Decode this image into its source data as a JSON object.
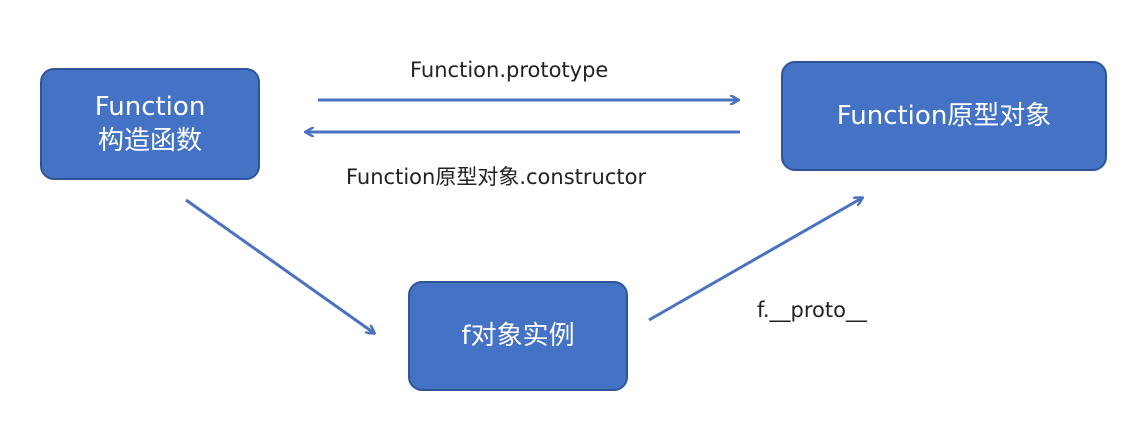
{
  "nodes": {
    "constructor": {
      "line1": "Function",
      "line2": "构造函数"
    },
    "prototype": {
      "label": "Function原型对象"
    },
    "instance": {
      "label": "f对象实例"
    }
  },
  "edges": {
    "constructor_to_prototype": "Function.prototype",
    "prototype_to_constructor": "Function原型对象.constructor",
    "instance_to_prototype": "f.__proto__"
  },
  "colors": {
    "node_fill": "#4472c4",
    "node_border": "#2f5597",
    "arrow": "#4a72c0"
  }
}
